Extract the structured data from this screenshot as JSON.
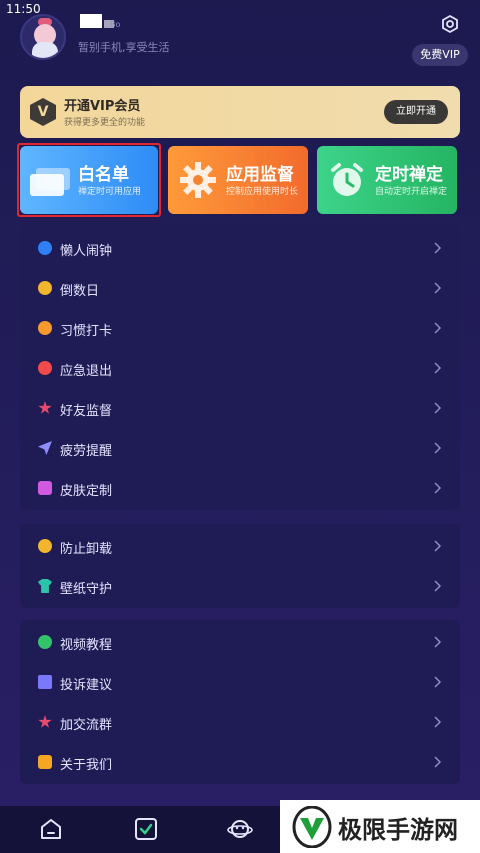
{
  "status": {
    "time": "11:50"
  },
  "header": {
    "username": "Bo",
    "subtitle": "暂别手机,享受生活",
    "vip_label": "免费VIP"
  },
  "vip_banner": {
    "logo": "V",
    "title": "开通VIP会员",
    "subtitle": "获得更多更全的功能",
    "button": "立即开通"
  },
  "cards": [
    {
      "title": "白名单",
      "subtitle": "禅定时可用应用",
      "color": "#2e8cf5"
    },
    {
      "title": "应用监督",
      "subtitle": "控制应用使用时长",
      "color": "#f26b2c"
    },
    {
      "title": "定时禅定",
      "subtitle": "自动定时开启禅定",
      "color": "#24b562"
    }
  ],
  "menu_group1": [
    {
      "label": "懒人闹钟",
      "icon": "alarm-icon",
      "color": "#2f7ff5"
    },
    {
      "label": "倒数日",
      "icon": "countdown-icon",
      "color": "#f2b52e"
    },
    {
      "label": "习惯打卡",
      "icon": "location-pin-icon",
      "color": "#f59a2e"
    },
    {
      "label": "应急退出",
      "icon": "emergency-icon",
      "color": "#ef4b4b"
    },
    {
      "label": "好友监督",
      "icon": "star-icon",
      "color": "#e84a6a"
    },
    {
      "label": "疲劳提醒",
      "icon": "send-icon",
      "color": "#8f8cff"
    },
    {
      "label": "皮肤定制",
      "icon": "skin-icon",
      "color": "#d05adf"
    }
  ],
  "menu_group2": [
    {
      "label": "防止卸载",
      "icon": "shield-face-icon",
      "color": "#f2b52e"
    },
    {
      "label": "壁纸守护",
      "icon": "shirt-icon",
      "color": "#2bc4a8"
    }
  ],
  "menu_group3": [
    {
      "label": "视频教程",
      "icon": "play-icon",
      "color": "#33c46b"
    },
    {
      "label": "投诉建议",
      "icon": "note-icon",
      "color": "#7a78ff"
    },
    {
      "label": "加交流群",
      "icon": "star-icon",
      "color": "#e84a6a"
    },
    {
      "label": "关于我们",
      "icon": "chat-icon",
      "color": "#f5a623"
    }
  ],
  "bottom_nav": [
    {
      "icon": "home-icon"
    },
    {
      "icon": "check-icon"
    },
    {
      "icon": "planet-icon"
    }
  ],
  "watermark": {
    "text": "极限手游网"
  }
}
